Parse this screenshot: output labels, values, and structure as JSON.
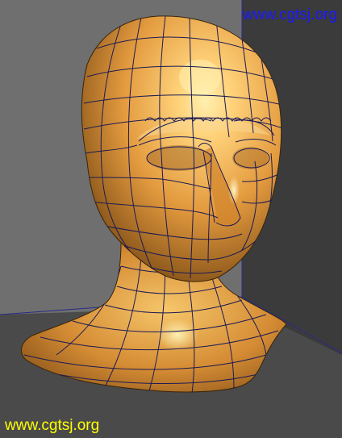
{
  "viewport": {
    "colors": {
      "background_wall": "#6b6b6b",
      "dark_corner": "#3a3a3a",
      "floor": "#4a4a4a",
      "model_light": "#ffd27a",
      "model_mid": "#e6a04a",
      "model_dark": "#7a4a14",
      "wireframe": "#1a1a55"
    }
  },
  "watermarks": {
    "top": {
      "text": "www.cgtsj.org",
      "color": "#1a1aff"
    },
    "bottom": {
      "text": "www.cgtsj.org",
      "color": "#ffff00"
    }
  }
}
